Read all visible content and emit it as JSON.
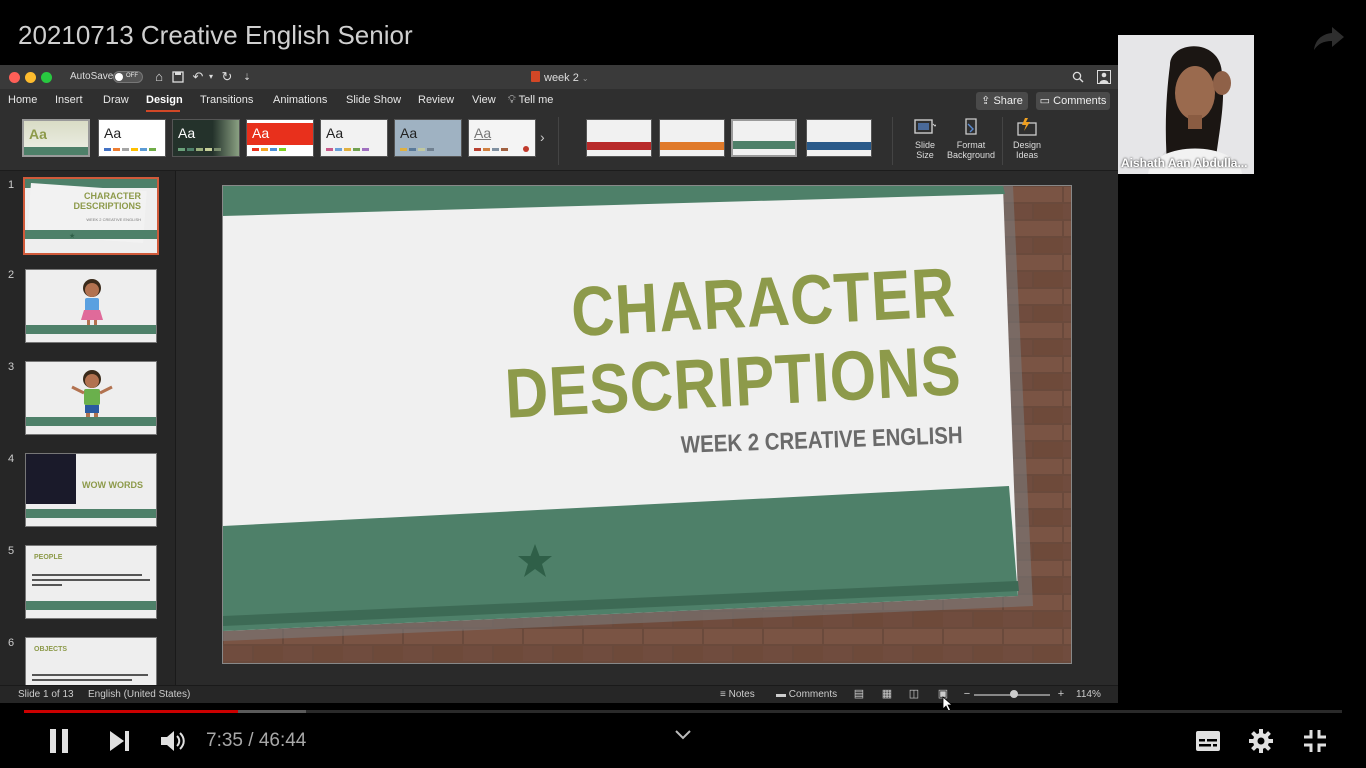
{
  "video": {
    "title": "20210713 Creative English Senior",
    "time_display": "7:35 / 46:44",
    "progress_fraction": 0.162
  },
  "powerpoint": {
    "autosave_label": "AutoSave",
    "autosave_state": "OFF",
    "document_name": "week 2",
    "tabs": [
      "Home",
      "Insert",
      "Draw",
      "Design",
      "Transitions",
      "Animations",
      "Slide Show",
      "Review",
      "View",
      "Tell me"
    ],
    "active_tab": "Design",
    "share_label": "Share",
    "comments_label": "Comments",
    "theme_sample_text": "Aa",
    "ribbon_buttons": {
      "slide_size": [
        "Slide",
        "Size"
      ],
      "format_background": [
        "Format",
        "Background"
      ],
      "design_ideas": [
        "Design",
        "Ideas"
      ]
    },
    "slide": {
      "title_line1": "CHARACTER",
      "title_line2": "DESCRIPTIONS",
      "subtitle": "WEEK 2 CREATIVE ENGLISH"
    },
    "thumbnails": [
      {
        "num": "1",
        "title": "CHARACTER DESCRIPTIONS",
        "sub": "WEEK 2 CREATIVE ENGLISH"
      },
      {
        "num": "2"
      },
      {
        "num": "3"
      },
      {
        "num": "4",
        "title": "WOW WORDS"
      },
      {
        "num": "5",
        "title": "PEOPLE"
      },
      {
        "num": "6",
        "title": "OBJECTS"
      }
    ],
    "status": {
      "slide_info": "Slide 1 of 13",
      "language": "English (United States)",
      "notes_label": "Notes",
      "comments_label": "Comments",
      "zoom": "114%"
    }
  },
  "participant": {
    "name": "Aishath Aan Abdulla..."
  },
  "colors": {
    "slide_green": "#4e8069",
    "title_olive": "#8d9a4a",
    "accent_orange": "#d24726",
    "progress_red": "#cc0000"
  }
}
